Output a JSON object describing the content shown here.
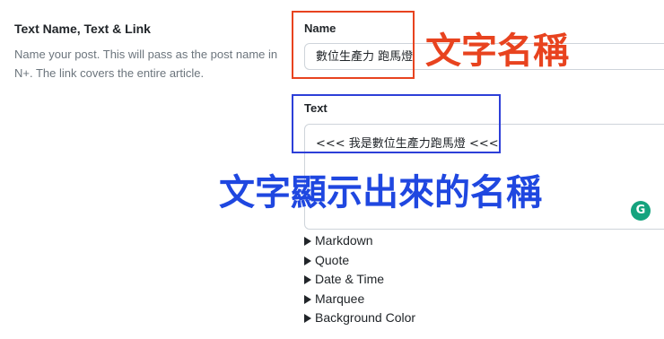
{
  "section": {
    "title": "Text Name, Text & Link",
    "description": "Name your post. This will pass as the post name in N+. The link covers the entire article."
  },
  "name_field": {
    "label": "Name",
    "value": "數位生產力 跑馬燈"
  },
  "text_field": {
    "label": "Text",
    "value": "<<< 我是數位生產力跑馬燈 <<<"
  },
  "grammarly": {
    "icon": "grammarly-icon",
    "glyph": "G",
    "color": "#15a37e"
  },
  "annotations": {
    "name_annotation": "文字名稱",
    "text_annotation": "文字顯示出來的名稱",
    "red_color": "#e8431f",
    "blue_color": "#1f47e0"
  },
  "details": [
    {
      "label": "Markdown"
    },
    {
      "label": "Quote"
    },
    {
      "label": "Date & Time"
    },
    {
      "label": "Marquee"
    },
    {
      "label": "Background Color"
    }
  ]
}
